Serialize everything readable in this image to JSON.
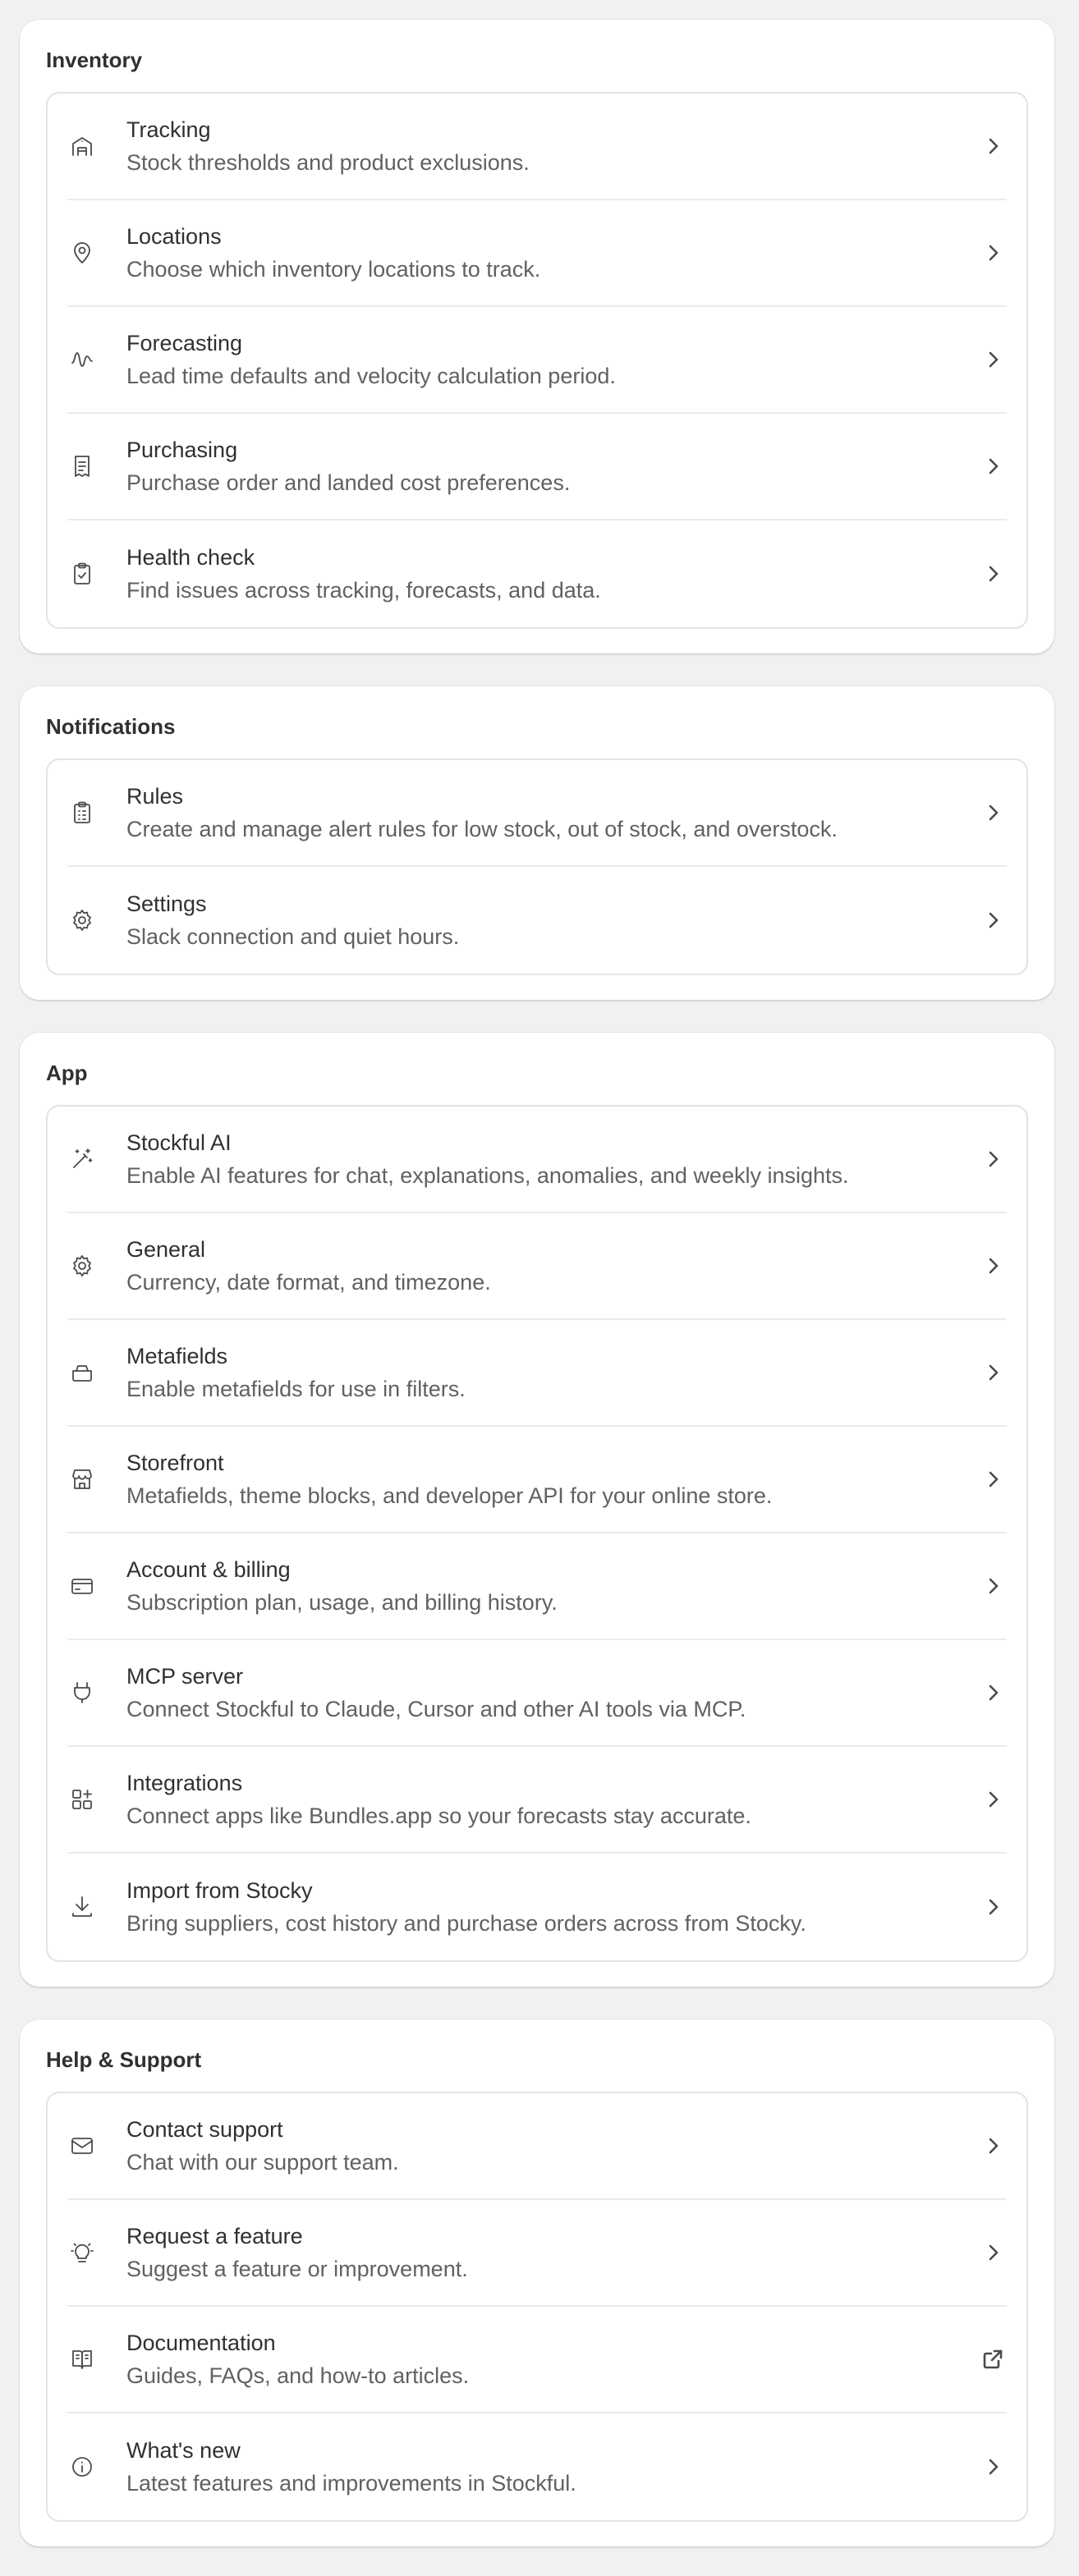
{
  "inventory": {
    "title": "Inventory",
    "items": [
      {
        "title": "Tracking",
        "desc": "Stock thresholds and product exclusions.",
        "icon": "warehouse-icon",
        "action": "chevron-right-icon"
      },
      {
        "title": "Locations",
        "desc": "Choose which inventory locations to track.",
        "icon": "location-pin-icon",
        "action": "chevron-right-icon"
      },
      {
        "title": "Forecasting",
        "desc": "Lead time defaults and velocity calculation period.",
        "icon": "wave-icon",
        "action": "chevron-right-icon"
      },
      {
        "title": "Purchasing",
        "desc": "Purchase order and landed cost preferences.",
        "icon": "receipt-icon",
        "action": "chevron-right-icon"
      },
      {
        "title": "Health check",
        "desc": "Find issues across tracking, forecasts, and data.",
        "icon": "clipboard-check-icon",
        "action": "chevron-right-icon"
      }
    ]
  },
  "notifications": {
    "title": "Notifications",
    "items": [
      {
        "title": "Rules",
        "desc": "Create and manage alert rules for low stock, out of stock, and overstock.",
        "icon": "clipboard-list-icon",
        "action": "chevron-right-icon"
      },
      {
        "title": "Settings",
        "desc": "Slack connection and quiet hours.",
        "icon": "gear-icon",
        "action": "chevron-right-icon"
      }
    ]
  },
  "app": {
    "title": "App",
    "items": [
      {
        "title": "Stockful AI",
        "desc": "Enable AI features for chat, explanations, anomalies, and weekly insights.",
        "icon": "magic-wand-icon",
        "action": "chevron-right-icon"
      },
      {
        "title": "General",
        "desc": "Currency, date format, and timezone.",
        "icon": "gear-icon",
        "action": "chevron-right-icon"
      },
      {
        "title": "Metafields",
        "desc": "Enable metafields for use in filters.",
        "icon": "metafield-icon",
        "action": "chevron-right-icon"
      },
      {
        "title": "Storefront",
        "desc": "Metafields, theme blocks, and developer API for your online store.",
        "icon": "store-icon",
        "action": "chevron-right-icon"
      },
      {
        "title": "Account & billing",
        "desc": "Subscription plan, usage, and billing history.",
        "icon": "credit-card-icon",
        "action": "chevron-right-icon"
      },
      {
        "title": "MCP server",
        "desc": "Connect Stockful to Claude, Cursor and other AI tools via MCP.",
        "icon": "plug-icon",
        "action": "chevron-right-icon"
      },
      {
        "title": "Integrations",
        "desc": "Connect apps like Bundles.app so your forecasts stay accurate.",
        "icon": "apps-add-icon",
        "action": "chevron-right-icon"
      },
      {
        "title": "Import from Stocky",
        "desc": "Bring suppliers, cost history and purchase orders across from Stocky.",
        "icon": "download-icon",
        "action": "chevron-right-icon"
      }
    ]
  },
  "help": {
    "title": "Help & Support",
    "items": [
      {
        "title": "Contact support",
        "desc": "Chat with our support team.",
        "icon": "envelope-icon",
        "action": "chevron-right-icon"
      },
      {
        "title": "Request a feature",
        "desc": "Suggest a feature or improvement.",
        "icon": "lightbulb-icon",
        "action": "chevron-right-icon"
      },
      {
        "title": "Documentation",
        "desc": "Guides, FAQs, and how-to articles.",
        "icon": "book-icon",
        "action": "external-link-icon"
      },
      {
        "title": "What's new",
        "desc": "Latest features and improvements in Stockful.",
        "icon": "info-icon",
        "action": "chevron-right-icon"
      }
    ]
  }
}
